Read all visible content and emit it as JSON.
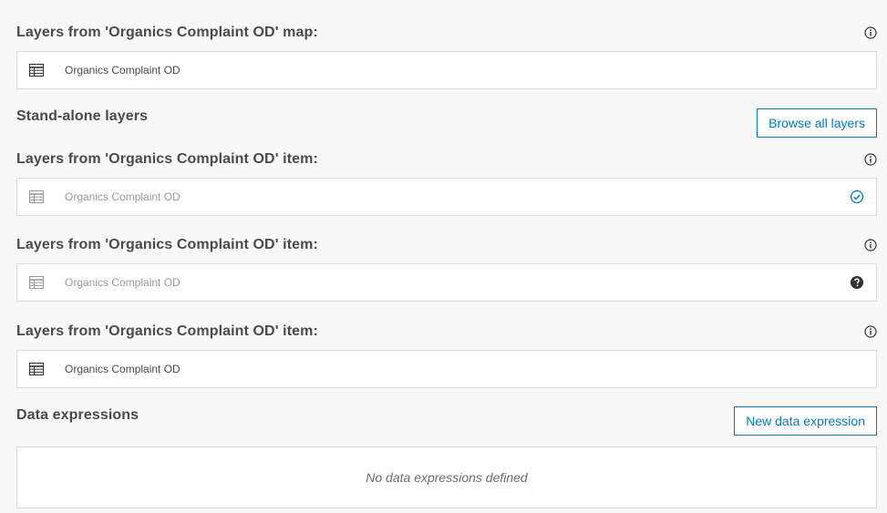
{
  "sections": [
    {
      "title": "Layers from 'Organics Complaint OD' map:",
      "layer_name": "Organics Complaint OD",
      "status": "none",
      "disabled": false
    },
    {
      "title": "Layers from 'Organics Complaint OD' item:",
      "layer_name": "Organics Complaint OD",
      "status": "selected-check-icon",
      "disabled": true
    },
    {
      "title": "Layers from 'Organics Complaint OD' item:",
      "layer_name": "Organics Complaint OD",
      "status": "question-icon",
      "disabled": true
    },
    {
      "title": "Layers from 'Organics Complaint OD' item:",
      "layer_name": "Organics Complaint OD",
      "status": "none",
      "disabled": false
    }
  ],
  "standalone": {
    "title": "Stand-alone layers",
    "browse_label": "Browse all layers"
  },
  "data_expressions": {
    "title": "Data expressions",
    "new_label": "New data expression",
    "empty_text": "No data expressions defined"
  },
  "colors": {
    "accent": "#007ac2",
    "background": "#f8f8f8",
    "border": "#dcdcdc"
  }
}
